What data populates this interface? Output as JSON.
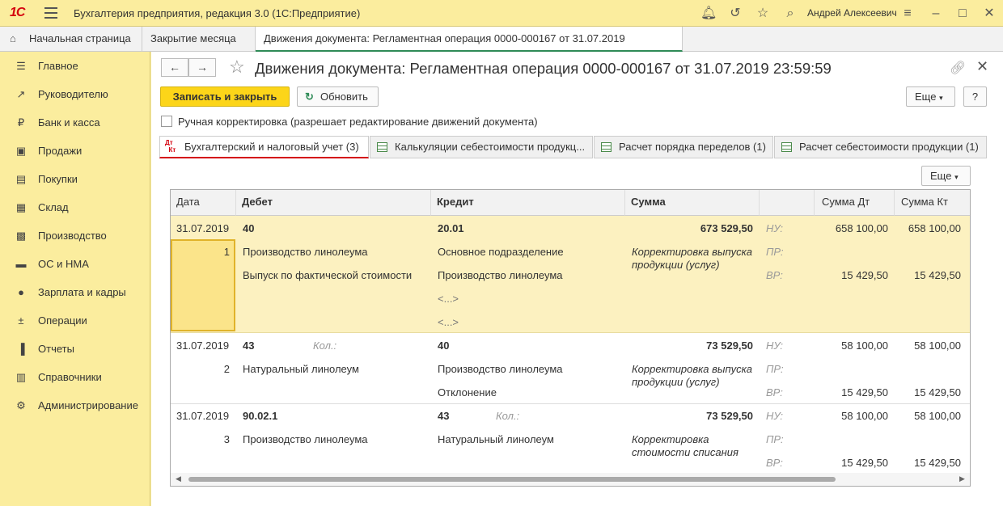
{
  "app": {
    "title": "Бухгалтерия предприятия, редакция 3.0 (1С:Предприятие)",
    "logo": "1С",
    "user": "Андрей Алексеевич"
  },
  "tabs": [
    {
      "label": "Начальная страница"
    },
    {
      "label": "Закрытие месяца"
    },
    {
      "label": "Движения документа: Регламентная операция 0000-000167 от 31.07.2019 23:59:59",
      "close": "×"
    }
  ],
  "sidebar": {
    "items": [
      {
        "label": "Главное",
        "icon": "menu-icon"
      },
      {
        "label": "Руководителю",
        "icon": "trend-icon"
      },
      {
        "label": "Банк и касса",
        "icon": "coin-icon"
      },
      {
        "label": "Продажи",
        "icon": "bag-icon"
      },
      {
        "label": "Покупки",
        "icon": "cart-icon"
      },
      {
        "label": "Склад",
        "icon": "grid-icon"
      },
      {
        "label": "Производство",
        "icon": "factory-icon"
      },
      {
        "label": "ОС и НМА",
        "icon": "truck-icon"
      },
      {
        "label": "Зарплата и кадры",
        "icon": "person-icon"
      },
      {
        "label": "Операции",
        "icon": "dtkt-icon"
      },
      {
        "label": "Отчеты",
        "icon": "bar-chart-icon"
      },
      {
        "label": "Справочники",
        "icon": "book-icon"
      },
      {
        "label": "Администрирование",
        "icon": "gear-icon"
      }
    ]
  },
  "doc": {
    "title": "Движения документа: Регламентная операция 0000-000167 от 31.07.2019 23:59:59",
    "save_close": "Записать и закрыть",
    "refresh": "Обновить",
    "more": "Еще",
    "help": "?",
    "manual_label": "Ручная корректировка (разрешает редактирование движений документа)",
    "inner_more": "Еще"
  },
  "form_tabs": [
    {
      "label": "Бухгалтерский и налоговый учет (3)",
      "icon_top": "Дт",
      "icon_bottom": "Кт"
    },
    {
      "label": "Калькуляции себестоимости продукц..."
    },
    {
      "label": "Расчет порядка переделов (1)"
    },
    {
      "label": "Расчет себестоимости продукции (1)"
    }
  ],
  "table": {
    "headers": {
      "date": "Дата",
      "debit": "Дебет",
      "credit": "Кредит",
      "sum": "Сумма",
      "sum_dt": "Сумма Дт",
      "sum_kt": "Сумма Кт"
    },
    "qty_label": "Кол.:",
    "nu": "НУ:",
    "pr": "ПР:",
    "vr": "ВР:",
    "rows": [
      {
        "date": "31.07.2019",
        "num": "1",
        "debit": "40",
        "debit_sub1": "Производство линолеума",
        "debit_sub2": "Выпуск по фактической стоимости",
        "credit": "20.01",
        "credit_sub1": "Основное подразделение",
        "credit_sub2": "Производство линолеума",
        "credit_sub3": "<...>",
        "credit_sub4": "<...>",
        "sum": "673 529,50",
        "content": "Корректировка выпуска продукции (услуг)",
        "nu_dt": "658 100,00",
        "nu_kt": "658 100,00",
        "vr_dt": "15 429,50",
        "vr_kt": "15 429,50"
      },
      {
        "date": "31.07.2019",
        "num": "2",
        "debit": "43",
        "debit_sub1": "Натуральный линолеум",
        "credit": "40",
        "credit_sub1": "Производство линолеума",
        "credit_sub2": "Отклонение",
        "sum": "73 529,50",
        "content": "Корректировка выпуска продукции (услуг)",
        "nu_dt": "58 100,00",
        "nu_kt": "58 100,00",
        "vr_dt": "15 429,50",
        "vr_kt": "15 429,50"
      },
      {
        "date": "31.07.2019",
        "num": "3",
        "debit": "90.02.1",
        "debit_sub1": "Производство линолеума",
        "credit": "43",
        "credit_sub1": "Натуральный линолеум",
        "sum": "73 529,50",
        "content": "Корректировка стоимости списания",
        "nu_dt": "58 100,00",
        "nu_kt": "58 100,00",
        "vr_dt": "15 429,50",
        "vr_kt": "15 429,50"
      }
    ]
  }
}
